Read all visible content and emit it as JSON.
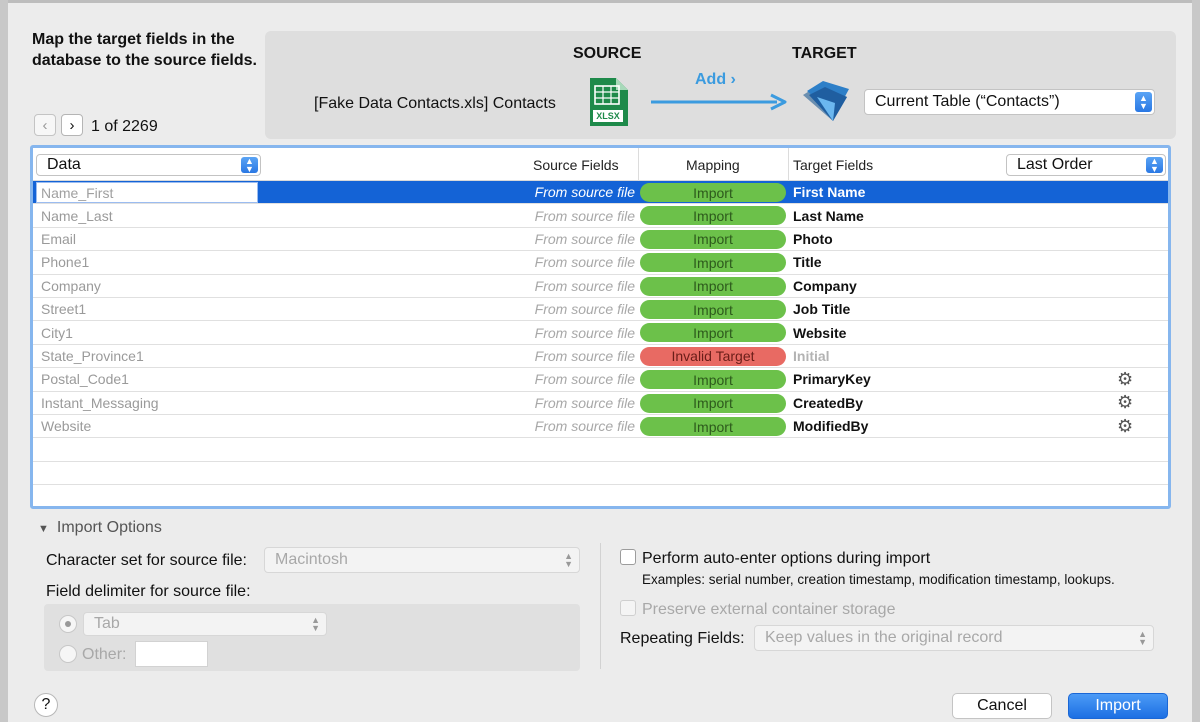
{
  "heading": "Map the target fields in the database to the source fields.",
  "navigation": {
    "prev": "‹",
    "next": "›",
    "count": "1 of 2269"
  },
  "header": {
    "source_title": "SOURCE",
    "target_title": "TARGET",
    "source_name": "[Fake Data Contacts.xls] Contacts",
    "file_badge": "XLSX",
    "add_label": "Add ›",
    "target_table": "Current Table (“Contacts”)"
  },
  "table": {
    "source_selector": "Data",
    "columns": {
      "source": "Source Fields",
      "mapping": "Mapping",
      "target": "Target Fields"
    },
    "order_selector": "Last Order",
    "rows": [
      {
        "source": "Name_First",
        "label": "From source file",
        "mapping": "Import",
        "target": "First Name",
        "status": "import",
        "selected": true,
        "gear": false
      },
      {
        "source": "Name_Last",
        "label": "From source file",
        "mapping": "Import",
        "target": "Last Name",
        "status": "import",
        "selected": false,
        "gear": false
      },
      {
        "source": "Email",
        "label": "From source file",
        "mapping": "Import",
        "target": "Photo",
        "status": "import",
        "selected": false,
        "gear": false
      },
      {
        "source": "Phone1",
        "label": "From source file",
        "mapping": "Import",
        "target": "Title",
        "status": "import",
        "selected": false,
        "gear": false
      },
      {
        "source": "Company",
        "label": "From source file",
        "mapping": "Import",
        "target": "Company",
        "status": "import",
        "selected": false,
        "gear": false
      },
      {
        "source": "Street1",
        "label": "From source file",
        "mapping": "Import",
        "target": "Job Title",
        "status": "import",
        "selected": false,
        "gear": false
      },
      {
        "source": "City1",
        "label": "From source file",
        "mapping": "Import",
        "target": "Website",
        "status": "import",
        "selected": false,
        "gear": false
      },
      {
        "source": "State_Province1",
        "label": "From source file",
        "mapping": "Invalid Target",
        "target": "Initial",
        "status": "invalid",
        "selected": false,
        "gear": false
      },
      {
        "source": "Postal_Code1",
        "label": "From source file",
        "mapping": "Import",
        "target": "PrimaryKey",
        "status": "import",
        "selected": false,
        "gear": true
      },
      {
        "source": "Instant_Messaging",
        "label": "From source file",
        "mapping": "Import",
        "target": "CreatedBy",
        "status": "import",
        "selected": false,
        "gear": true
      },
      {
        "source": "Website",
        "label": "From source file",
        "mapping": "Import",
        "target": "ModifiedBy",
        "status": "import",
        "selected": false,
        "gear": true
      }
    ],
    "empty_rows": 3
  },
  "options": {
    "toggle_label": "Import Options",
    "charset_label": "Character set for source file:",
    "charset_value": "Macintosh",
    "delimiter_label": "Field delimiter for source file:",
    "tab_value": "Tab",
    "other_label": "Other:",
    "other_value": "",
    "auto_enter_label": "Perform auto-enter options during import",
    "auto_enter_examples": "Examples: serial number, creation timestamp, modification timestamp, lookups.",
    "preserve_label": "Preserve external container storage",
    "repeating_label": "Repeating Fields:",
    "repeating_value": "Keep values in the original record"
  },
  "footer": {
    "help": "?",
    "cancel": "Cancel",
    "import": "Import"
  },
  "colors": {
    "accent": "#1463d6",
    "import_green": "#6cc14a",
    "invalid_red": "#e86a63",
    "arrow": "#3b9bdf"
  }
}
